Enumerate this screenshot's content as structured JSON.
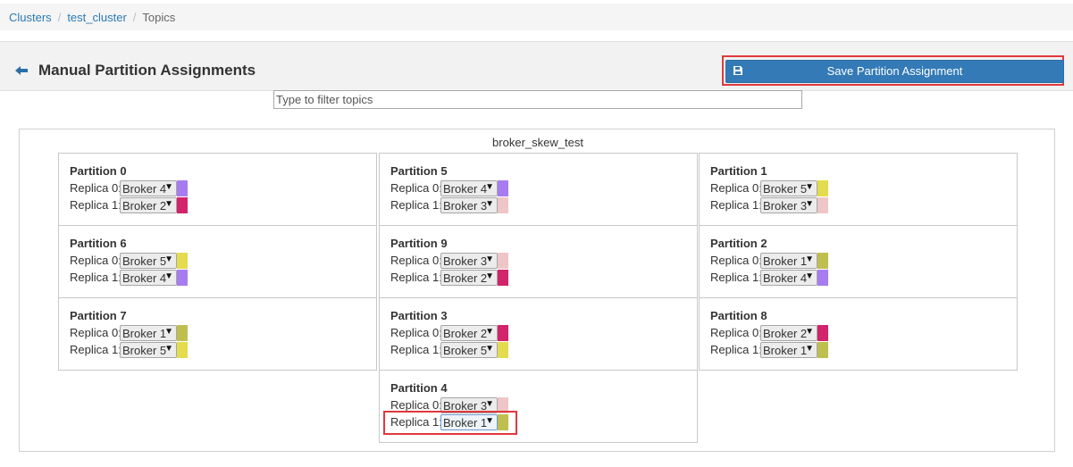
{
  "breadcrumb": {
    "items": [
      "Clusters",
      "test_cluster"
    ],
    "current": "Topics",
    "separator": "/"
  },
  "header": {
    "title": "Manual Partition Assignments",
    "save_label": "Save Partition Assignment"
  },
  "filter": {
    "placeholder": "Type to filter topics",
    "value": ""
  },
  "topic": {
    "name": "broker_skew_test"
  },
  "broker_colors": {
    "Broker 1": "#bfbf50",
    "Broker 2": "#d1246a",
    "Broker 3": "#efc6c6",
    "Broker 4": "#a77cf0",
    "Broker 5": "#e3dc4e"
  },
  "icons": {
    "back": "arrow-left-icon",
    "save": "floppy-disk-icon",
    "dropdown": "caret-down-icon"
  },
  "partitions": [
    {
      "title": "Partition 0",
      "replicas": [
        {
          "label": "Replica 0:",
          "broker": "Broker 4",
          "arrow": "▼"
        },
        {
          "label": "Replica 1:",
          "broker": "Broker 2",
          "arrow": "▼"
        }
      ]
    },
    {
      "title": "Partition 5",
      "replicas": [
        {
          "label": "Replica 0:",
          "broker": "Broker 4",
          "arrow": "▼"
        },
        {
          "label": "Replica 1:",
          "broker": "Broker 3",
          "arrow": "▼"
        }
      ]
    },
    {
      "title": "Partition 1",
      "replicas": [
        {
          "label": "Replica 0:",
          "broker": "Broker 5",
          "arrow": "▼"
        },
        {
          "label": "Replica 1:",
          "broker": "Broker 3",
          "arrow": "▼"
        }
      ]
    },
    {
      "title": "Partition 6",
      "replicas": [
        {
          "label": "Replica 0:",
          "broker": "Broker 5",
          "arrow": "▼"
        },
        {
          "label": "Replica 1:",
          "broker": "Broker 4",
          "arrow": "▼"
        }
      ]
    },
    {
      "title": "Partition 9",
      "replicas": [
        {
          "label": "Replica 0:",
          "broker": "Broker 3",
          "arrow": "▼"
        },
        {
          "label": "Replica 1:",
          "broker": "Broker 2",
          "arrow": "▼"
        }
      ]
    },
    {
      "title": "Partition 2",
      "replicas": [
        {
          "label": "Replica 0:",
          "broker": "Broker 1",
          "arrow": "▼"
        },
        {
          "label": "Replica 1:",
          "broker": "Broker 4",
          "arrow": "▼"
        }
      ]
    },
    {
      "title": "Partition 7",
      "replicas": [
        {
          "label": "Replica 0:",
          "broker": "Broker 1",
          "arrow": "▼"
        },
        {
          "label": "Replica 1:",
          "broker": "Broker 5",
          "arrow": "▼"
        }
      ]
    },
    {
      "title": "Partition 3",
      "replicas": [
        {
          "label": "Replica 0:",
          "broker": "Broker 2",
          "arrow": "▼"
        },
        {
          "label": "Replica 1:",
          "broker": "Broker 5",
          "arrow": "▼"
        }
      ]
    },
    {
      "title": "Partition 8",
      "replicas": [
        {
          "label": "Replica 0:",
          "broker": "Broker 2",
          "arrow": "▼"
        },
        {
          "label": "Replica 1:",
          "broker": "Broker 1",
          "arrow": "▼"
        }
      ]
    },
    {
      "title": "Partition 4",
      "replicas": [
        {
          "label": "Replica 0:",
          "broker": "Broker 3",
          "arrow": "▼"
        },
        {
          "label": "Replica 1:",
          "broker": "Broker 1",
          "arrow": "▼"
        }
      ]
    }
  ]
}
